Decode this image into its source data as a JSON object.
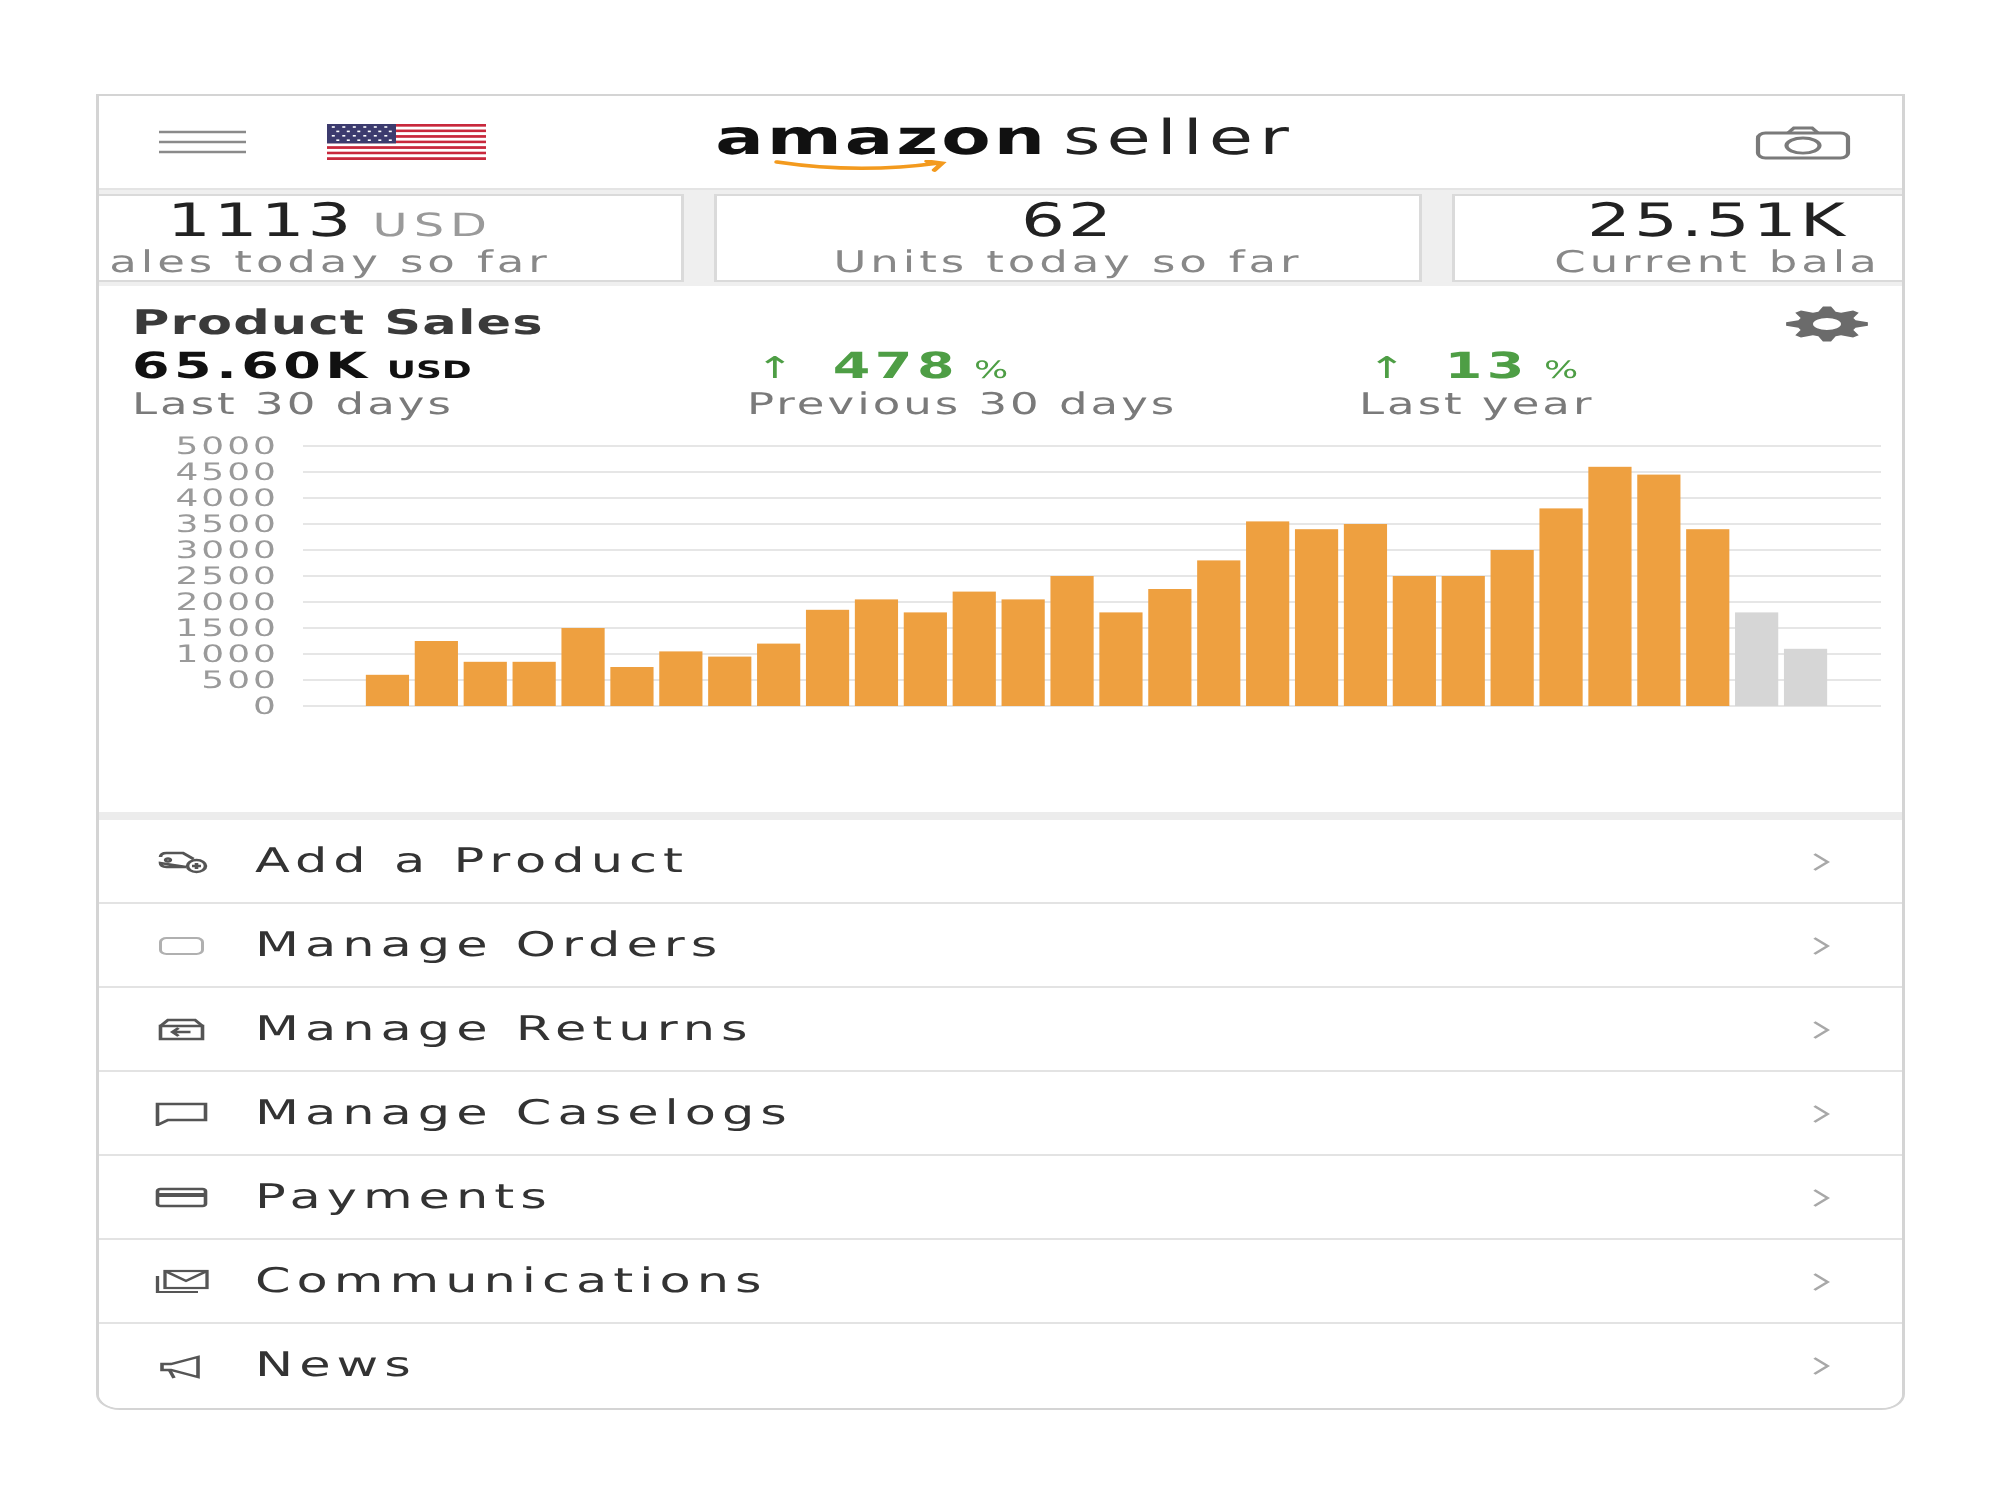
{
  "header": {
    "logo": {
      "brand": "amazon",
      "product": "seller"
    }
  },
  "summary_cards": [
    {
      "value": "1113",
      "unit": "USD",
      "label": "ales today so far"
    },
    {
      "value": "62",
      "label": "Units today so far"
    },
    {
      "value": "25.51K",
      "label": "Current bala"
    }
  ],
  "product_sales": {
    "title": "Product Sales",
    "total": {
      "value": "65.60K",
      "unit": "USD",
      "label": "Last 30 days"
    },
    "comparisons": [
      {
        "arrow": "↑",
        "value": "478",
        "unit": "%",
        "label": "Previous 30 days"
      },
      {
        "arrow": "↑",
        "value": "13",
        "unit": "%",
        "label": "Last year"
      }
    ],
    "chart_data": [
      {
        "type": "bar",
        "categories": [
          null,
          null,
          null,
          null,
          null,
          null,
          null,
          null,
          null,
          null,
          null,
          null,
          null,
          null,
          null,
          null,
          null,
          null,
          null,
          null,
          null,
          null,
          null,
          null,
          null,
          null,
          null,
          null,
          null,
          null
        ],
        "values": [
          600,
          1250,
          850,
          850,
          1500,
          750,
          1050,
          950,
          1200,
          1850,
          2050,
          1800,
          2200,
          2050,
          2500,
          1800,
          2250,
          2800,
          3550,
          3400,
          3500,
          2500,
          2500,
          3000,
          3800,
          4600,
          4450,
          3400,
          1800,
          1100
        ],
        "colors": [
          "#eea040",
          "#eea040",
          "#eea040",
          "#eea040",
          "#eea040",
          "#eea040",
          "#eea040",
          "#eea040",
          "#eea040",
          "#eea040",
          "#eea040",
          "#eea040",
          "#eea040",
          "#eea040",
          "#eea040",
          "#eea040",
          "#eea040",
          "#eea040",
          "#eea040",
          "#eea040",
          "#eea040",
          "#eea040",
          "#eea040",
          "#eea040",
          "#eea040",
          "#eea040",
          "#eea040",
          "#eea040",
          "#d6d6d6",
          "#d6d6d6"
        ],
        "ylim": [
          0,
          5000
        ],
        "yticks": [
          0,
          500,
          1000,
          1500,
          2000,
          2500,
          3000,
          3500,
          4000,
          4500,
          5000
        ],
        "tick_labels": "y",
        "grid": true
      }
    ]
  },
  "menu": [
    {
      "label": "Add a Product"
    },
    {
      "label": "Manage Orders"
    },
    {
      "label": "Manage Returns"
    },
    {
      "label": "Manage Caselogs"
    },
    {
      "label": "Payments"
    },
    {
      "label": "Communications"
    },
    {
      "label": "News"
    }
  ]
}
